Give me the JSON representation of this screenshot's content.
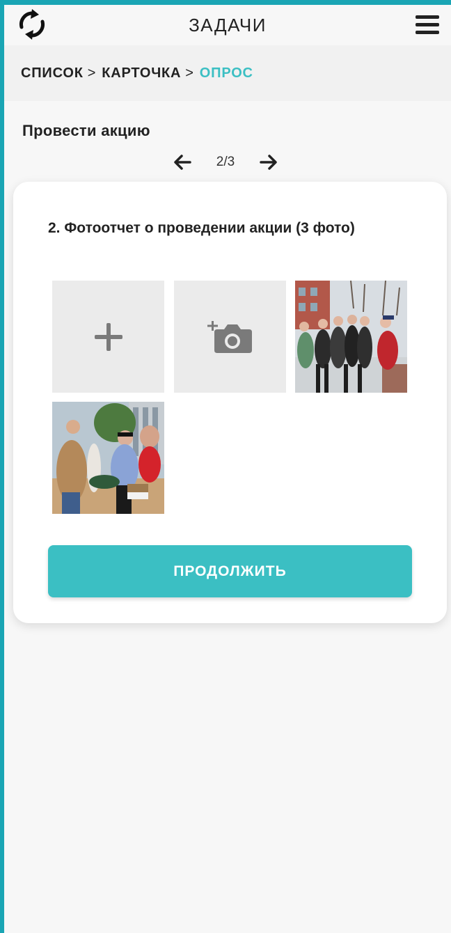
{
  "header": {
    "title": "ЗАДАЧИ",
    "refresh_icon": "refresh-icon",
    "menu_icon": "hamburger-menu-icon"
  },
  "breadcrumbs": {
    "items": [
      "СПИСОК",
      "КАРТОЧКА",
      "ОПРОС"
    ],
    "separator": ">",
    "active_color": "#3bbfc3"
  },
  "task": {
    "title": "Провести акцию"
  },
  "pager": {
    "counter": "2/3",
    "prev_icon": "arrow-left-icon",
    "next_icon": "arrow-right-icon"
  },
  "question": {
    "text": "2. Фотоотчет о проведении акции (3 фото)"
  },
  "photos": {
    "add_icon": "plus-icon",
    "camera_icon": "camera-add-icon",
    "thumbnails": [
      "photo-group-winter",
      "photo-event-outdoor"
    ]
  },
  "actions": {
    "continue_label": "ПРОДОЛЖИТЬ"
  },
  "colors": {
    "accent": "#3bbfc3",
    "frame": "#1aa5b4",
    "tile_bg": "#ebebeb"
  }
}
